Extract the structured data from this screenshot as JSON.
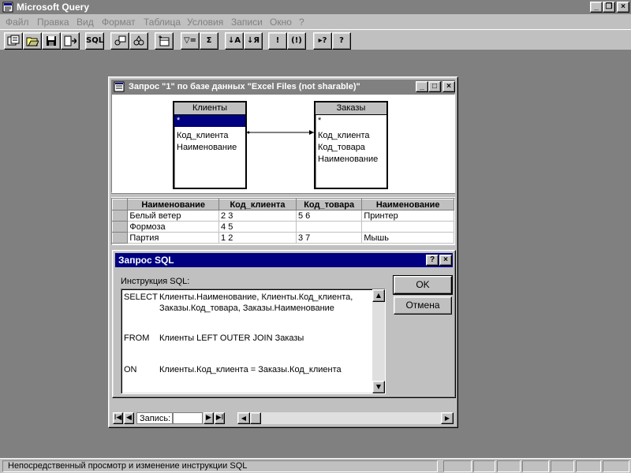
{
  "app": {
    "title": "Microsoft Query",
    "caption_buttons": [
      "_",
      "❐",
      "×"
    ]
  },
  "menu": [
    {
      "label": "Файл"
    },
    {
      "label": "Правка"
    },
    {
      "label": "Вид"
    },
    {
      "label": "Формат"
    },
    {
      "label": "Таблица"
    },
    {
      "label": "Условия"
    },
    {
      "label": "Записи"
    },
    {
      "label": "Окно"
    },
    {
      "label": "?"
    }
  ],
  "toolbar": {
    "sql_label": "SQL",
    "filter_label": "▽=",
    "sum_label": "Σ",
    "sort_asc_label": "↓A",
    "sort_desc_label": "↓Я",
    "query_now_label": "!",
    "auto_query_label": "(!)",
    "help_label": "?",
    "context_help_label": "▸?"
  },
  "query_window": {
    "title": "Запрос \"1\" по базе данных \"Excel Files (not sharable)\"",
    "tables": [
      {
        "name": "Клиенты",
        "fields": [
          "*",
          "Код_клиента",
          "Наименование"
        ]
      },
      {
        "name": "Заказы",
        "fields": [
          "*",
          "Код_клиента",
          "Код_товара",
          "Наименование"
        ]
      }
    ],
    "grid": {
      "columns": [
        "Наименование",
        "Код_клиента",
        "Код_товара",
        "Наименование"
      ],
      "rows": [
        [
          "Белый ветер",
          "2 3",
          "5 6",
          "Принтер"
        ],
        [
          "Формоза",
          "4 5",
          "",
          ""
        ],
        [
          "Партия",
          "1 2",
          "3 7",
          "Мышь"
        ]
      ]
    },
    "nav": {
      "record_label": "Запись:",
      "record_value": "",
      "first": "I◀",
      "prev": "◀",
      "next": "▶",
      "last": "▶I"
    }
  },
  "sql_dialog": {
    "title": "Запрос SQL",
    "help_btn": "?",
    "close_btn": "×",
    "label": "Инструкция SQL:",
    "sql": [
      {
        "kw": "SELECT",
        "text": "Клиенты.Наименование, Клиенты.Код_клиента,"
      },
      {
        "kw": "",
        "text": "Заказы.Код_товара, Заказы.Наименование"
      },
      {
        "kw": "FROM",
        "text": "Клиенты LEFT OUTER JOIN  Заказы"
      },
      {
        "kw": "ON",
        "text": "Клиенты.Код_клиента = Заказы.Код_клиента"
      }
    ],
    "ok_label": "OK",
    "cancel_label": "Отмена"
  },
  "statusbar": {
    "text": "Непосредственный просмотр и изменение инструкции SQL"
  },
  "icons": {
    "app": "query-app-icon",
    "new_query": "new-query-icon",
    "open": "open-folder-icon",
    "save": "save-disk-icon",
    "return_data": "return-data-icon"
  },
  "colors": {
    "desktop": "#808080",
    "face": "#c0c0c0",
    "active_title": "#000080",
    "inactive_title": "#808080",
    "selection": "#000080"
  }
}
